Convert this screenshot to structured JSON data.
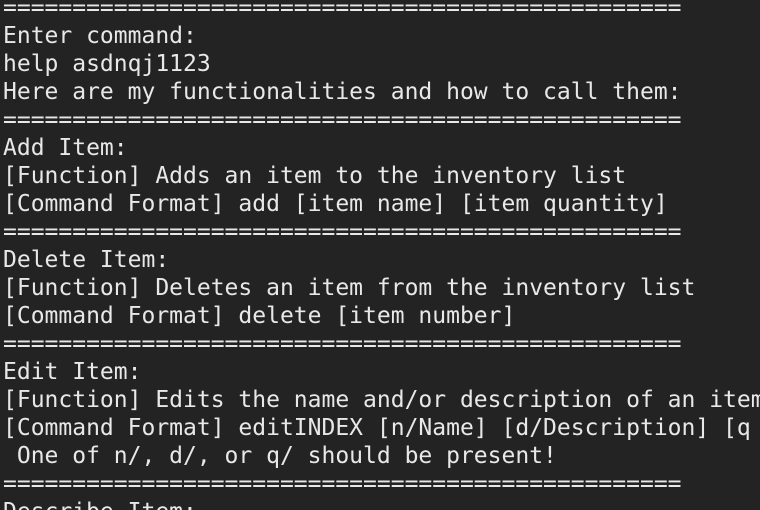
{
  "terminal": {
    "lines": [
      "=================================================",
      "Enter command:",
      "help asdnqj1123",
      "Here are my functionalities and how to call them:",
      "=================================================",
      "Add Item:",
      "[Function] Adds an item to the inventory list",
      "[Command Format] add [item name] [item quantity]",
      "=================================================",
      "Delete Item:",
      "[Function] Deletes an item from the inventory list",
      "[Command Format] delete [item number]",
      "=================================================",
      "Edit Item:",
      "[Function] Edits the name and/or description of an item",
      "[Command Format] editINDEX [n/Name] [d/Description] [q",
      " One of n/, d/, or q/ should be present!",
      "=================================================",
      "Describe Item:"
    ]
  }
}
